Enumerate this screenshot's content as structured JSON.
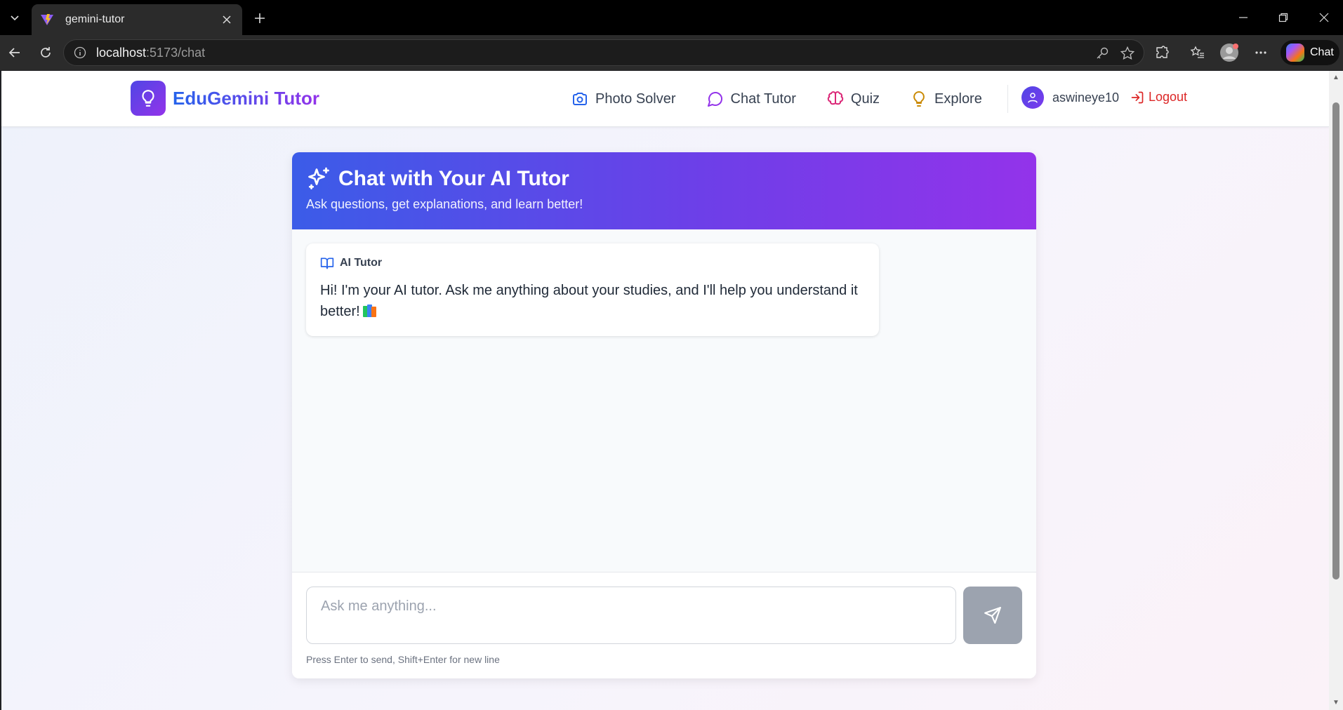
{
  "browser": {
    "tab_title": "gemini-tutor",
    "url_host": "localhost",
    "url_rest": ":5173/chat",
    "copilot_label": "Chat"
  },
  "nav": {
    "brand": "EduGemini Tutor",
    "links": [
      {
        "label": "Photo Solver",
        "icon": "camera-icon"
      },
      {
        "label": "Chat Tutor",
        "icon": "chat-bubble-icon"
      },
      {
        "label": "Quiz",
        "icon": "brain-icon"
      },
      {
        "label": "Explore",
        "icon": "lightbulb-icon"
      }
    ],
    "username": "aswineye10",
    "logout": "Logout"
  },
  "chat": {
    "title": "Chat with Your AI Tutor",
    "subtitle": "Ask questions, get explanations, and learn better!",
    "messages": [
      {
        "author": "AI Tutor",
        "text": "Hi! I'm your AI tutor. Ask me anything about your studies, and I'll help you understand it better!"
      }
    ],
    "input_placeholder": "Ask me anything...",
    "hint": "Press Enter to send, Shift+Enter for new line"
  },
  "colors": {
    "brand_gradient_start": "#2563eb",
    "brand_gradient_end": "#9333ea",
    "logout": "#dc2626",
    "send_disabled": "#9ca3af"
  }
}
